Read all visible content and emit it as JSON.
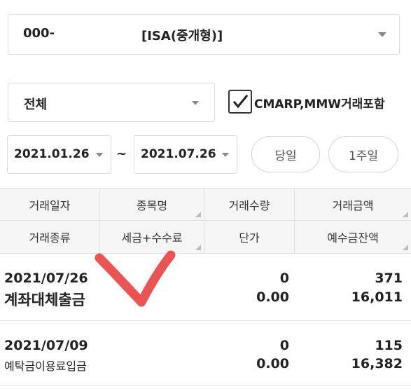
{
  "account": {
    "number": "000-",
    "type": "[ISA(중개형)]"
  },
  "filter": {
    "scope": "전체",
    "checkbox_label": "CMARP,MMW거래포함",
    "checked": true
  },
  "dates": {
    "start": "2021.01.26",
    "separator": "~",
    "end": "2021.07.26"
  },
  "quick": {
    "today": "당일",
    "week": "1주일"
  },
  "table": {
    "headers_row1": [
      "거래일자",
      "종목명",
      "거래수량",
      "거래금액"
    ],
    "headers_row2": [
      "거래종류",
      "세금+수수료",
      "단가",
      "예수금잔액"
    ]
  },
  "rows": [
    {
      "date": "2021/07/26",
      "kind": "계좌대체출금",
      "qty": "0",
      "price": "0.00",
      "amount": "371",
      "balance": "16,011"
    },
    {
      "date": "2021/07/09",
      "kind": "예탁금이용료입금",
      "qty": "0",
      "price": "0.00",
      "amount": "115",
      "balance": "16,382"
    }
  ],
  "colors": {
    "annotation_checkmark": "#e8413f",
    "header_bg": "#f5f5f5"
  }
}
